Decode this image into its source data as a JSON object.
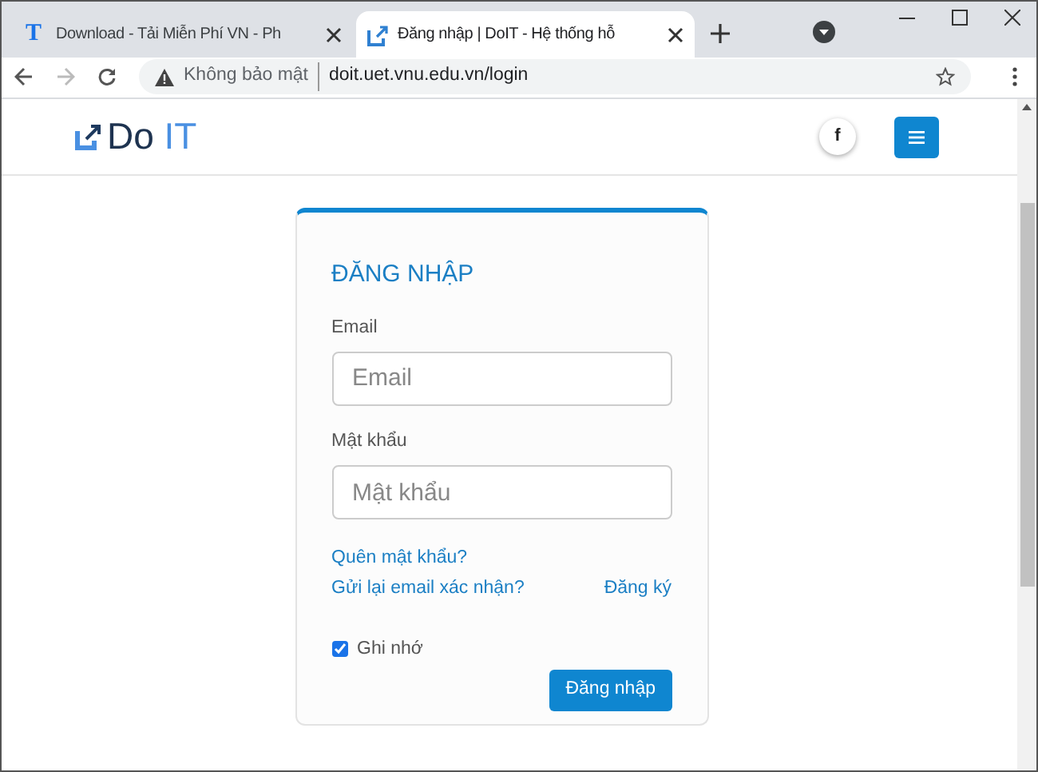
{
  "browser": {
    "tabs": [
      {
        "favicon_text": "T",
        "title": "Download - Tải Miễn Phí VN - Ph",
        "selected": false
      },
      {
        "title": "Đăng nhập | DoIT - Hệ thống hỗ",
        "selected": true
      }
    ],
    "security": "Không bảo mật",
    "url": "doit.uet.vnu.edu.vn/login"
  },
  "header": {
    "logo": [
      "Do",
      "IT"
    ],
    "facebook": "f"
  },
  "login": {
    "title": "ĐĂNG NHẬP",
    "fields": [
      {
        "label": "Email",
        "placeholder": "Email"
      },
      {
        "label": "Mật khẩu",
        "placeholder": "Mật khẩu"
      }
    ],
    "forgot_link": "Quên mật khẩu?",
    "resend_link": "Gửi lại email xác nhận?",
    "register_link": "Đăng ký",
    "remember": {
      "label": "Ghi nhớ",
      "checked": true
    },
    "submit": "Đăng nhập"
  }
}
